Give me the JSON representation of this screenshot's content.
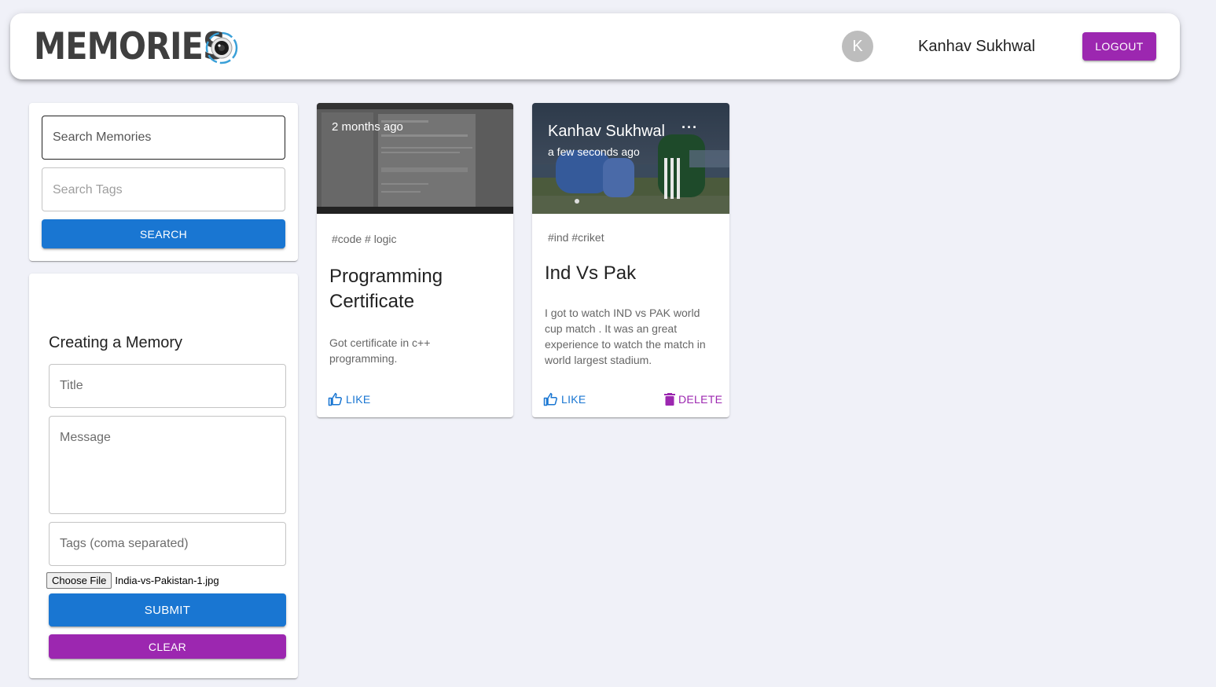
{
  "header": {
    "brand": "MEMORIES",
    "brand_icon": "camera-lens-icon",
    "avatar_letter": "K",
    "username": "Kanhav Sukhwal",
    "logout_label": "LOGOUT"
  },
  "search": {
    "memories_placeholder": "Search Memories",
    "tags_placeholder": "Search Tags",
    "button_label": "SEARCH"
  },
  "form": {
    "title": "Creating a Memory",
    "title_placeholder": "Title",
    "message_placeholder": "Message",
    "tags_placeholder": "Tags (coma separated)",
    "choose_file_label": "Choose File",
    "file_name": "India-vs-Pakistan-1.jpg",
    "submit_label": "SUBMIT",
    "clear_label": "CLEAR"
  },
  "posts": [
    {
      "creator": "",
      "time": "2 months ago",
      "tags": "#code # logic",
      "title": "Programming Certificate",
      "message": "Got certificate in c++ programming.",
      "like_label": "LIKE"
    },
    {
      "creator": "Kanhav Sukhwal",
      "time": "a few seconds ago",
      "more_icon": "more-horizontal-icon",
      "tags": "#ind #criket",
      "title": "Ind Vs Pak",
      "message": "I got to watch IND vs PAK world cup match . It was an great experience to watch the match in world largest stadium.",
      "like_label": "LIKE",
      "delete_label": "DELETE"
    }
  ],
  "colors": {
    "primary": "#1976d2",
    "secondary": "#9c27b0",
    "background": "#f0f1f8"
  }
}
